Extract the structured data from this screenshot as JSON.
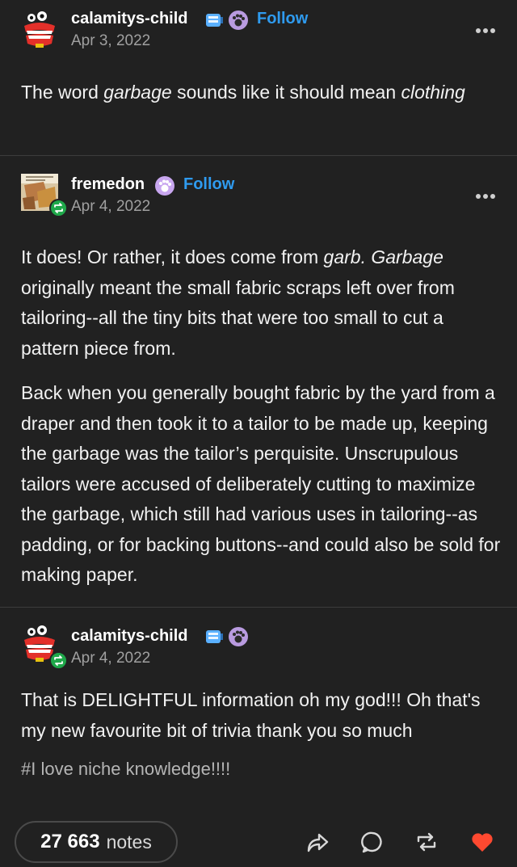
{
  "posts": [
    {
      "username": "calamitys-child",
      "date": "Apr 3, 2022",
      "follow_label": "Follow",
      "body_runs": [
        {
          "text": "The word "
        },
        {
          "text": "garbage",
          "italic": true
        },
        {
          "text": " sounds like it should mean "
        },
        {
          "text": "clothing",
          "italic": true
        }
      ]
    },
    {
      "username": "fremedon",
      "date": "Apr 4, 2022",
      "follow_label": "Follow",
      "paragraph1_runs": [
        {
          "text": "It does! Or rather, it does come from "
        },
        {
          "text": "garb. Garbage",
          "italic": true
        },
        {
          "text": " originally meant the small fabric scraps left over from tailoring--all the tiny bits that were too small to cut a pattern piece from."
        }
      ],
      "paragraph2": "Back when you generally bought fabric by the yard from a draper and then took it to a tailor to be made up, keeping the garbage was the tailor’s perquisite. Unscrupulous tailors were accused of deliberately cutting to maximize the garbage, which still had various uses in tailoring--as padding, or for backing buttons--and could also be sold for making paper."
    },
    {
      "username": "calamitys-child",
      "date": "Apr 4, 2022",
      "body": "That is DELIGHTFUL information oh my god!!! Oh that's my new favourite bit of trivia thank you so much",
      "tags": "#I love niche knowledge!!!!"
    }
  ],
  "footer": {
    "notes_count": "27 663",
    "notes_label": "notes",
    "icons": [
      "share-icon",
      "reply-icon",
      "reblog-icon",
      "like-icon"
    ],
    "like_color": "#ff4930"
  },
  "colors": {
    "background": "#212121",
    "follow": "#2f9bef",
    "reblog_badge": "#1fa84a"
  }
}
